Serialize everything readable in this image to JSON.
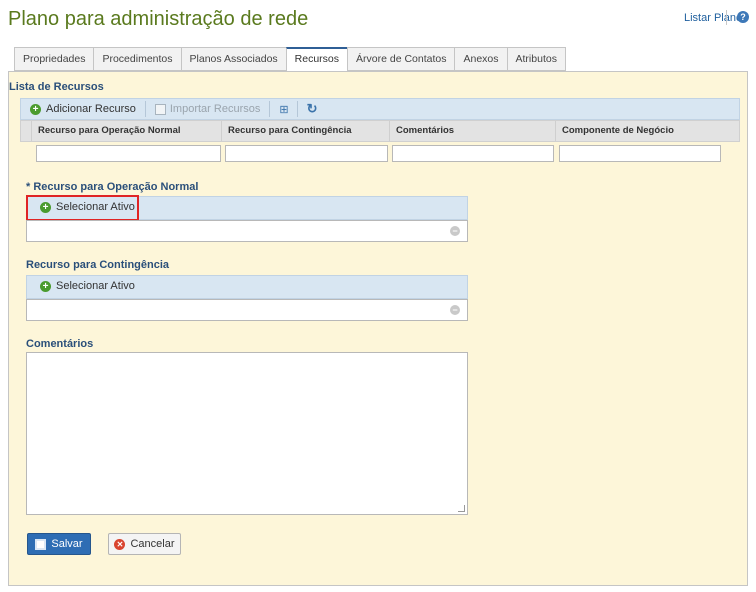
{
  "page": {
    "title": "Plano para administração de rede"
  },
  "header": {
    "list_plans_link": "Listar Planos",
    "help_icon_glyph": "?"
  },
  "tabs": [
    {
      "label": "Propriedades"
    },
    {
      "label": "Procedimentos"
    },
    {
      "label": "Planos Associados"
    },
    {
      "label": "Recursos",
      "active": true
    },
    {
      "label": "Árvore de Contatos"
    },
    {
      "label": "Anexos"
    },
    {
      "label": "Atributos"
    }
  ],
  "resource_list": {
    "title": "Lista de Recursos",
    "toolbar": {
      "add_label": "Adicionar Recurso",
      "import_label": "Importar Recursos",
      "icons": [
        "plus-icon",
        "import-icon",
        "tree-icon",
        "refresh-icon"
      ]
    },
    "columns": [
      "Recurso para Operação Normal",
      "Recurso para Contingência",
      "Comentários",
      "Componente de Negócio"
    ],
    "filters": [
      "",
      "",
      "",
      ""
    ]
  },
  "form": {
    "normal_resource": {
      "label": "* Recurso para Operação Normal",
      "select_label": "Selecionar Ativo",
      "value": ""
    },
    "contingency_resource": {
      "label": "Recurso para Contingência",
      "select_label": "Selecionar Ativo",
      "value": ""
    },
    "comments": {
      "label": "Comentários",
      "value": ""
    },
    "save_label": "Salvar",
    "cancel_label": "Cancelar"
  },
  "colors": {
    "title": "#5a7a1e",
    "panel_background": "#fdf6d9",
    "toolbar_background": "#d8e6f2",
    "label_text": "#2a4f7a",
    "primary_button": "#2e6db4",
    "highlight_box": "#e02424"
  }
}
